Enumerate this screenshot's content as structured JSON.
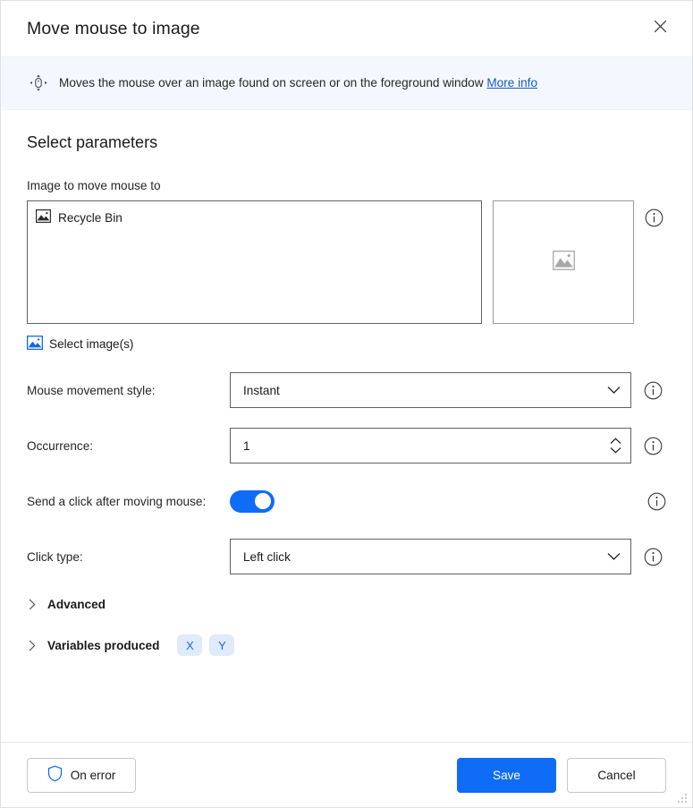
{
  "window": {
    "title": "Move mouse to image",
    "close_icon": "close-icon"
  },
  "banner": {
    "icon": "move-mouse-icon",
    "text": "Moves the mouse over an image found on screen or on the foreground window",
    "link_label": "More info"
  },
  "main": {
    "section_title": "Select parameters",
    "image_field": {
      "label": "Image to move mouse to",
      "items": [
        {
          "icon": "image-icon",
          "label": "Recycle Bin"
        }
      ],
      "preview_placeholder_icon": "image-placeholder-icon",
      "select_images_label": "Select image(s)",
      "select_images_icon": "image-icon-blue",
      "info_icon": "info-icon"
    },
    "rows": [
      {
        "label": "Mouse movement style:",
        "type": "dropdown",
        "value": "Instant",
        "chevron_icon": "chevron-down-icon",
        "info_icon": "info-icon"
      },
      {
        "label": "Occurrence:",
        "type": "number",
        "value": "1",
        "spinner_up_icon": "chevron-up-icon",
        "spinner_down_icon": "chevron-down-icon",
        "info_icon": "info-icon"
      },
      {
        "label": "Send a click after moving mouse:",
        "type": "toggle",
        "value": "on",
        "info_icon": "info-icon"
      },
      {
        "label": "Click type:",
        "type": "dropdown",
        "value": "Left click",
        "chevron_icon": "chevron-down-icon",
        "info_icon": "info-icon"
      }
    ],
    "expanders": [
      {
        "label": "Advanced",
        "caret_icon": "chevron-right-icon",
        "pills": []
      },
      {
        "label": "Variables produced",
        "caret_icon": "chevron-right-icon",
        "pills": [
          "X",
          "Y"
        ]
      }
    ]
  },
  "footer": {
    "on_error_label": "On error",
    "on_error_icon": "shield-icon",
    "save_label": "Save",
    "cancel_label": "Cancel",
    "resize_grip_icon": "resize-grip-icon"
  },
  "colors": {
    "accent": "#0f6cf6",
    "link": "#1558c6",
    "banner_bg": "#f4f8fe",
    "pill_bg": "#dfeafb",
    "pill_text": "#1a6ae0"
  }
}
